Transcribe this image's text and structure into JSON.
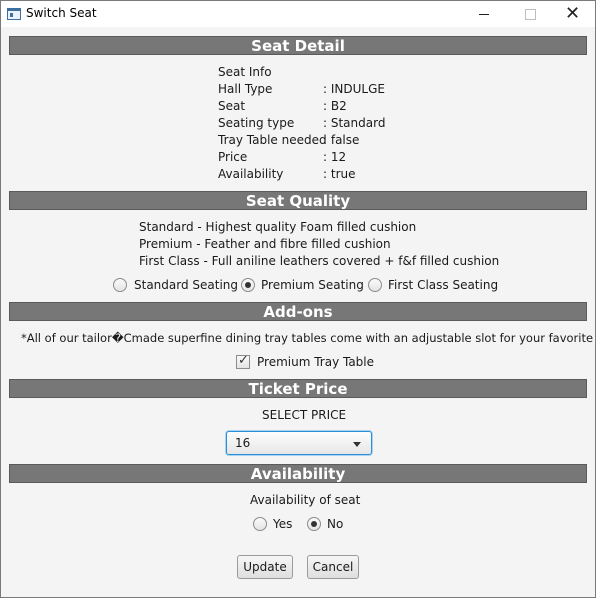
{
  "window": {
    "title": "Switch Seat"
  },
  "sections": {
    "seat_detail": "Seat Detail",
    "seat_quality": "Seat Quality",
    "add_ons": "Add-ons",
    "ticket_price": "Ticket Price",
    "availability": "Availability"
  },
  "seat_info": {
    "heading": "Seat Info",
    "rows": [
      {
        "label": "Hall Type",
        "value": ": INDULGE"
      },
      {
        "label": "Seat",
        "value": ": B2"
      },
      {
        "label": "Seating type",
        "value": ": Standard"
      },
      {
        "label": "Tray Table needed",
        "value": ": false"
      },
      {
        "label": "Price",
        "value": ": 12"
      },
      {
        "label": "Availability",
        "value": ": true"
      }
    ]
  },
  "quality": {
    "descriptions": [
      "Standard - Highest quality Foam filled cushion",
      "Premium - Feather and fibre filled cushion",
      "First Class - Full aniline leathers covered + f&f filled cushion"
    ],
    "options": [
      "Standard Seating",
      "Premium Seating",
      "First Class Seating"
    ],
    "selected": "Premium Seating"
  },
  "addons": {
    "note": "*All of our tailor�Cmade superfine dining tray tables come with an adjustable slot for your favorite drink",
    "tray_label": "Premium Tray Table",
    "tray_checked": true
  },
  "price": {
    "label": "SELECT PRICE",
    "selected": "16"
  },
  "availability": {
    "label": "Availability of seat",
    "options": [
      "Yes",
      "No"
    ],
    "selected": "No"
  },
  "buttons": {
    "update": "Update",
    "cancel": "Cancel"
  }
}
